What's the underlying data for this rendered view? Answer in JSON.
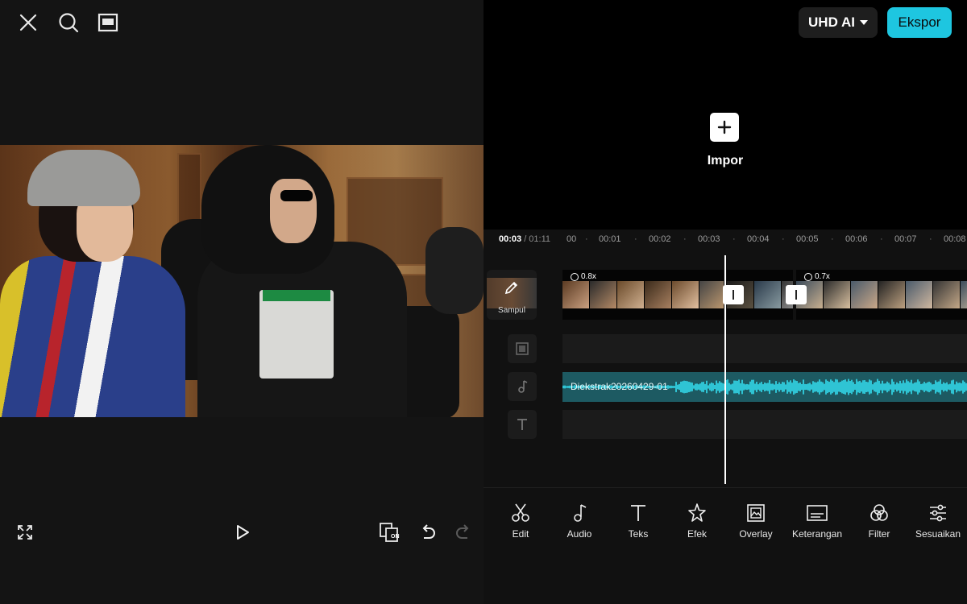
{
  "preview": {
    "top_icons": [
      "close-icon",
      "search-icon",
      "layout-icon"
    ],
    "bottom_icons": [
      "fullscreen-icon",
      "play-icon",
      "auto-enhance-on-icon",
      "undo-icon",
      "redo-icon"
    ],
    "enhance_badge": "ON"
  },
  "header": {
    "quality_label": "UHD AI",
    "export_label": "Ekspor"
  },
  "import": {
    "label": "Impor"
  },
  "timeline": {
    "current_time": "00:03",
    "total_time": " / 01:11",
    "ruler_ticks": [
      "00",
      "00:01",
      "00:02",
      "00:03",
      "00:04",
      "00:05",
      "00:06",
      "00:07",
      "00:08"
    ],
    "cover_label": "Sampul",
    "clips": [
      {
        "speed": "0.8x"
      },
      {
        "speed": ""
      },
      {
        "speed": "0.7x"
      }
    ],
    "audio_track_name": "Diekstrak20260429-01",
    "colors": {
      "audio_lane": "#1d5a62",
      "waveform": "#2fc4d4",
      "accent": "#1ec6e0"
    }
  },
  "toolbar": {
    "items": [
      {
        "label": "Edit",
        "icon": "scissors-icon"
      },
      {
        "label": "Audio",
        "icon": "music-note-icon"
      },
      {
        "label": "Teks",
        "icon": "text-icon"
      },
      {
        "label": "Efek",
        "icon": "sparkle-star-icon"
      },
      {
        "label": "Overlay",
        "icon": "overlay-image-icon"
      },
      {
        "label": "Keterangan",
        "icon": "captions-icon"
      },
      {
        "label": "Filter",
        "icon": "filter-circles-icon"
      },
      {
        "label": "Sesuaikan",
        "icon": "sliders-icon"
      }
    ]
  }
}
